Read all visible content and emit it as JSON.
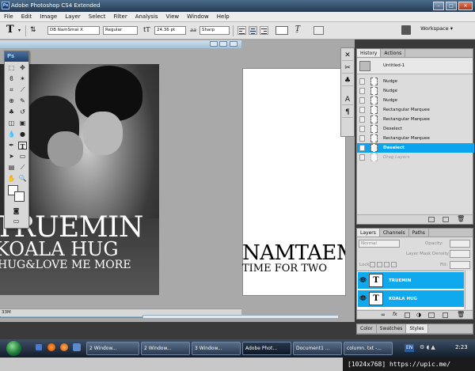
{
  "app": {
    "title": "Adobe Photoshop CS4 Extended",
    "icon": "Ps"
  },
  "menu": [
    "File",
    "Edit",
    "Image",
    "Layer",
    "Select",
    "Filter",
    "Analysis",
    "View",
    "Window",
    "Help"
  ],
  "options": {
    "font_family": "DB NamSmai X",
    "font_style": "Regular",
    "font_size": "24.36 pt",
    "aa": "Sharp",
    "aa_prefix": "aa",
    "workspace": "Workspace ▾"
  },
  "doc1": {
    "lines": [
      "TRUEMIN",
      "KOALA HUG",
      "HUG&LOVE  ME MORE"
    ],
    "zoom": "33M"
  },
  "doc2": {
    "lines": [
      "NAMTAEM",
      "TIME FOR TWO"
    ]
  },
  "history": {
    "tabs": [
      "History",
      "Actions"
    ],
    "snapshot": "Untitled-1",
    "items": [
      {
        "label": "Nudge",
        "state": "normal"
      },
      {
        "label": "Nudge",
        "state": "normal"
      },
      {
        "label": "Nudge",
        "state": "normal"
      },
      {
        "label": "Rectangular Marquee",
        "state": "normal"
      },
      {
        "label": "Rectangular Marquee",
        "state": "normal"
      },
      {
        "label": "Deselect",
        "state": "normal"
      },
      {
        "label": "Rectangular Marquee",
        "state": "normal"
      },
      {
        "label": "Deselect",
        "state": "selected"
      },
      {
        "label": "Drag Layers",
        "state": "dim"
      }
    ]
  },
  "layers": {
    "tabs": [
      "Layers",
      "Channels",
      "Paths"
    ],
    "blend": "Normal",
    "opacity_label": "Opacity:",
    "density_label": "Layer Mask Density",
    "lock_label": "Lock:",
    "fill_label": "Fill:",
    "items": [
      "TRUEMIN",
      "KOALA HUG"
    ]
  },
  "bottom_tabs": [
    "Color",
    "Swatches",
    "Styles"
  ],
  "taskbar": {
    "items": [
      "2 Window...",
      "2 Window...",
      "3 Window...",
      "Adobe Phot...",
      "Document1 ...",
      "column. txt -..."
    ],
    "lang": "EN",
    "time": "2:23"
  },
  "watermark": "[1024x768] https://upic.me/",
  "colors": {
    "selection": "#0aa3f0",
    "titlebar": "#243a52"
  }
}
